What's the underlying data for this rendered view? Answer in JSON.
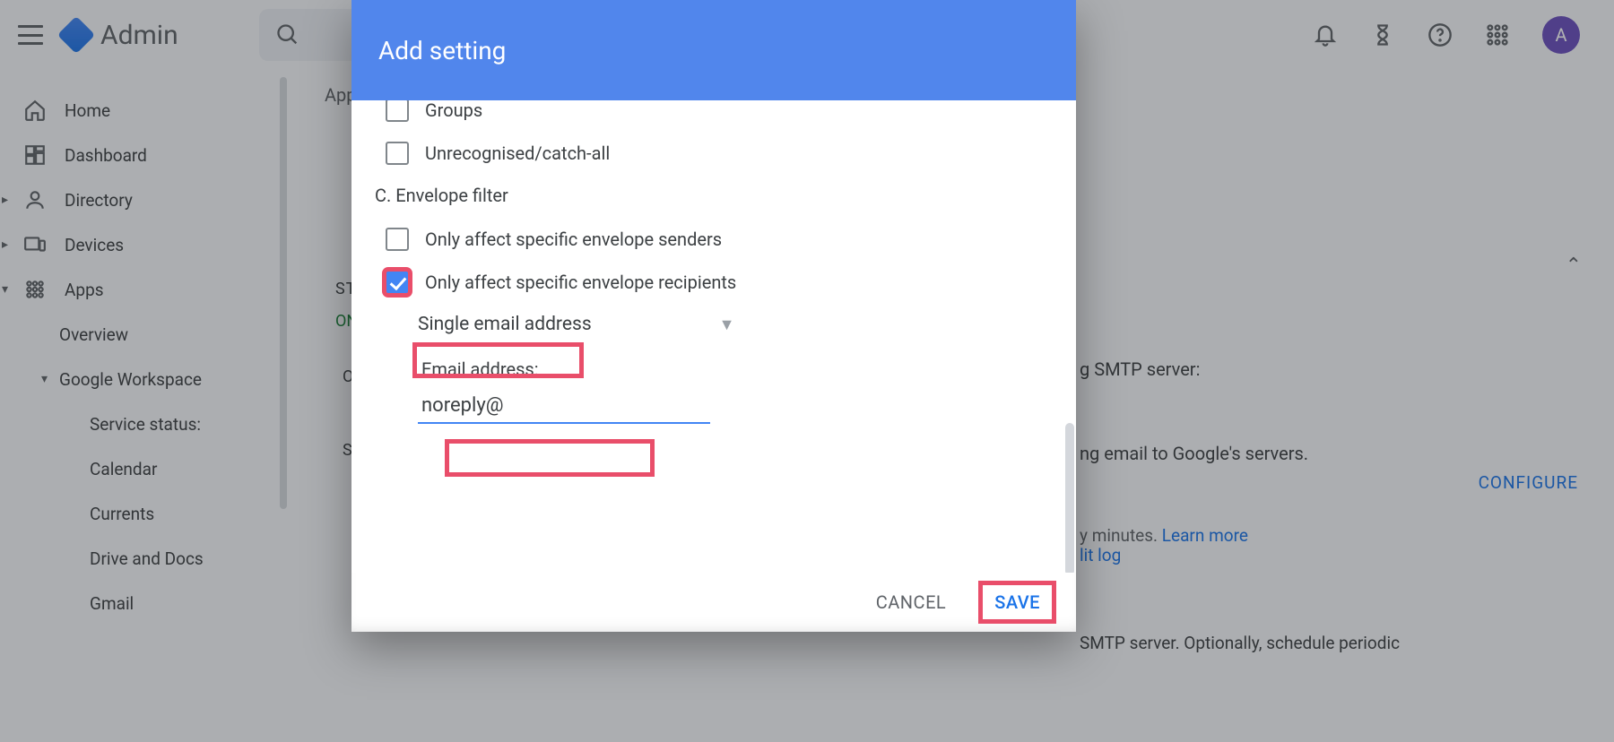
{
  "header": {
    "product": "Admin",
    "avatar_initial": "A"
  },
  "sidebar": {
    "items": [
      {
        "label": "Home"
      },
      {
        "label": "Dashboard"
      },
      {
        "label": "Directory"
      },
      {
        "label": "Devices"
      },
      {
        "label": "Apps"
      },
      {
        "label": "Overview"
      },
      {
        "label": "Google Workspace"
      },
      {
        "label": "Service status:"
      },
      {
        "label": "Calendar"
      },
      {
        "label": "Currents"
      },
      {
        "label": "Drive and Docs"
      },
      {
        "label": "Gmail"
      }
    ]
  },
  "content": {
    "breadcrumb": "App",
    "status_label": "ST",
    "status_value": "ON",
    "o_label": "O",
    "s_label": "S",
    "right_line1": "g SMTP server:",
    "right_line2": "ng email to Google's servers.",
    "configure": "CONFIGURE",
    "learn_tail": "y minutes. ",
    "learn_more": "Learn more",
    "lit_log": "lit log",
    "bottom_text": "SMTP server. Optionally, schedule periodic"
  },
  "dialog": {
    "title": "Add setting",
    "opt_groups": "Groups",
    "opt_catchall": "Unrecognised/catch-all",
    "section_c": "C. Envelope filter",
    "opt_senders": "Only affect specific envelope senders",
    "opt_recipients": "Only affect specific envelope recipients",
    "select_value": "Single email address",
    "email_label": "Email address:",
    "email_value": "noreply@",
    "cancel": "CANCEL",
    "save": "SAVE"
  },
  "colors": {
    "accent": "#4285f4",
    "highlight": "#e94e6a",
    "link": "#1a73e8",
    "green": "#188038"
  }
}
